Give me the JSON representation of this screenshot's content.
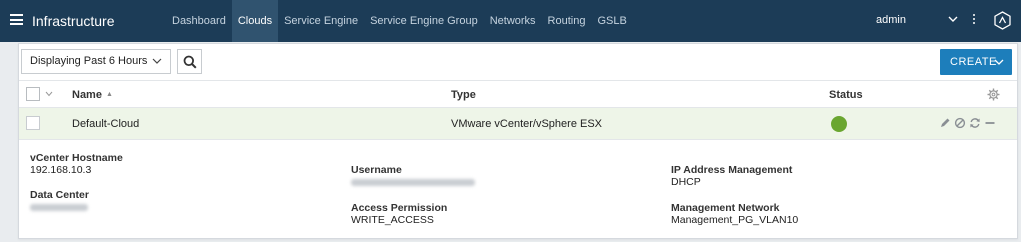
{
  "topbar": {
    "title": "Infrastructure",
    "nav": [
      "Dashboard",
      "Clouds",
      "Service Engine",
      "Service Engine Group",
      "Networks",
      "Routing",
      "GSLB"
    ],
    "active_nav": "Clouds",
    "user": "admin"
  },
  "toolbar": {
    "range_label": "Displaying Past 6 Hours",
    "create_label": "CREATE"
  },
  "table": {
    "headers": {
      "name": "Name",
      "type": "Type",
      "status": "Status"
    },
    "sort_indicator": "▲",
    "row": {
      "name": "Default-Cloud",
      "type": "VMware vCenter/vSphere ESX",
      "status_color": "#6aa630"
    }
  },
  "details": {
    "vcenter_hostname_label": "vCenter Hostname",
    "vcenter_hostname": "192.168.10.3",
    "data_center_label": "Data Center",
    "username_label": "Username",
    "access_permission_label": "Access Permission",
    "access_permission": "WRITE_ACCESS",
    "ip_mgmt_label": "IP Address Management",
    "ip_mgmt": "DHCP",
    "mgmt_network_label": "Management Network",
    "mgmt_network": "Management_PG_VLAN10"
  },
  "colors": {
    "topbar": "#1c3c57",
    "accent": "#1d7ebb",
    "row_highlight": "#eef5e8"
  }
}
